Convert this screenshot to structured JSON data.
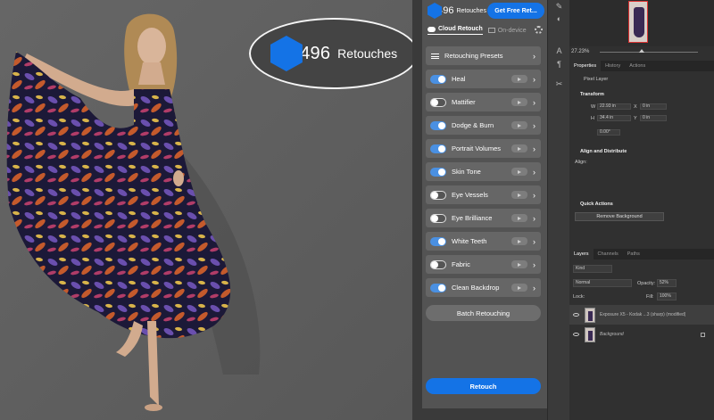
{
  "overlay": {
    "count": "1496",
    "word": "Retouches"
  },
  "plugin": {
    "header": {
      "count": "1496",
      "word": "Retouches",
      "cta": "Get Free Ret..."
    },
    "tabs": [
      {
        "label": "Cloud Retouch",
        "active": true
      },
      {
        "label": "On-device",
        "active": false
      }
    ],
    "presets_label": "Retouching Presets",
    "tools": [
      {
        "label": "Heal",
        "enabled": true
      },
      {
        "label": "Mattifier",
        "enabled": false
      },
      {
        "label": "Dodge & Burn",
        "enabled": true
      },
      {
        "label": "Portrait Volumes",
        "enabled": true
      },
      {
        "label": "Skin Tone",
        "enabled": true
      },
      {
        "label": "Eye Vessels",
        "enabled": false
      },
      {
        "label": "Eye Brilliance",
        "enabled": false
      },
      {
        "label": "White Teeth",
        "enabled": true
      },
      {
        "label": "Fabric",
        "enabled": false
      },
      {
        "label": "Clean Backdrop",
        "enabled": true
      }
    ],
    "batch_label": "Batch Retouching",
    "retouch_label": "Retouch"
  },
  "navigator": {
    "zoom": "27.23%"
  },
  "properties": {
    "tabs": [
      "Properties",
      "History",
      "Actions"
    ],
    "layer_type": "Pixel Layer",
    "transform_title": "Transform",
    "w_label": "W",
    "w_value": "22.93 in",
    "h_label": "H",
    "h_value": "34.4 in",
    "x_label": "X",
    "x_value": "0 in",
    "y_label": "Y",
    "y_value": "0 in",
    "angle": "0.00°",
    "align_title": "Align and Distribute",
    "align_label": "Align:",
    "quick_title": "Quick Actions",
    "remove_bg": "Remove Background"
  },
  "layers": {
    "tabs": [
      "Layers",
      "Channels",
      "Paths"
    ],
    "filter": "Kind",
    "blend": "Normal",
    "opacity_label": "Opacity:",
    "opacity": "52%",
    "lock_label": "Lock:",
    "fill_label": "Fill:",
    "fill": "100%",
    "items": [
      {
        "name": "Exposure X5 - Kodak ...3 (sharp) (modified)",
        "selected": true
      },
      {
        "name": "Background",
        "selected": false
      }
    ]
  }
}
